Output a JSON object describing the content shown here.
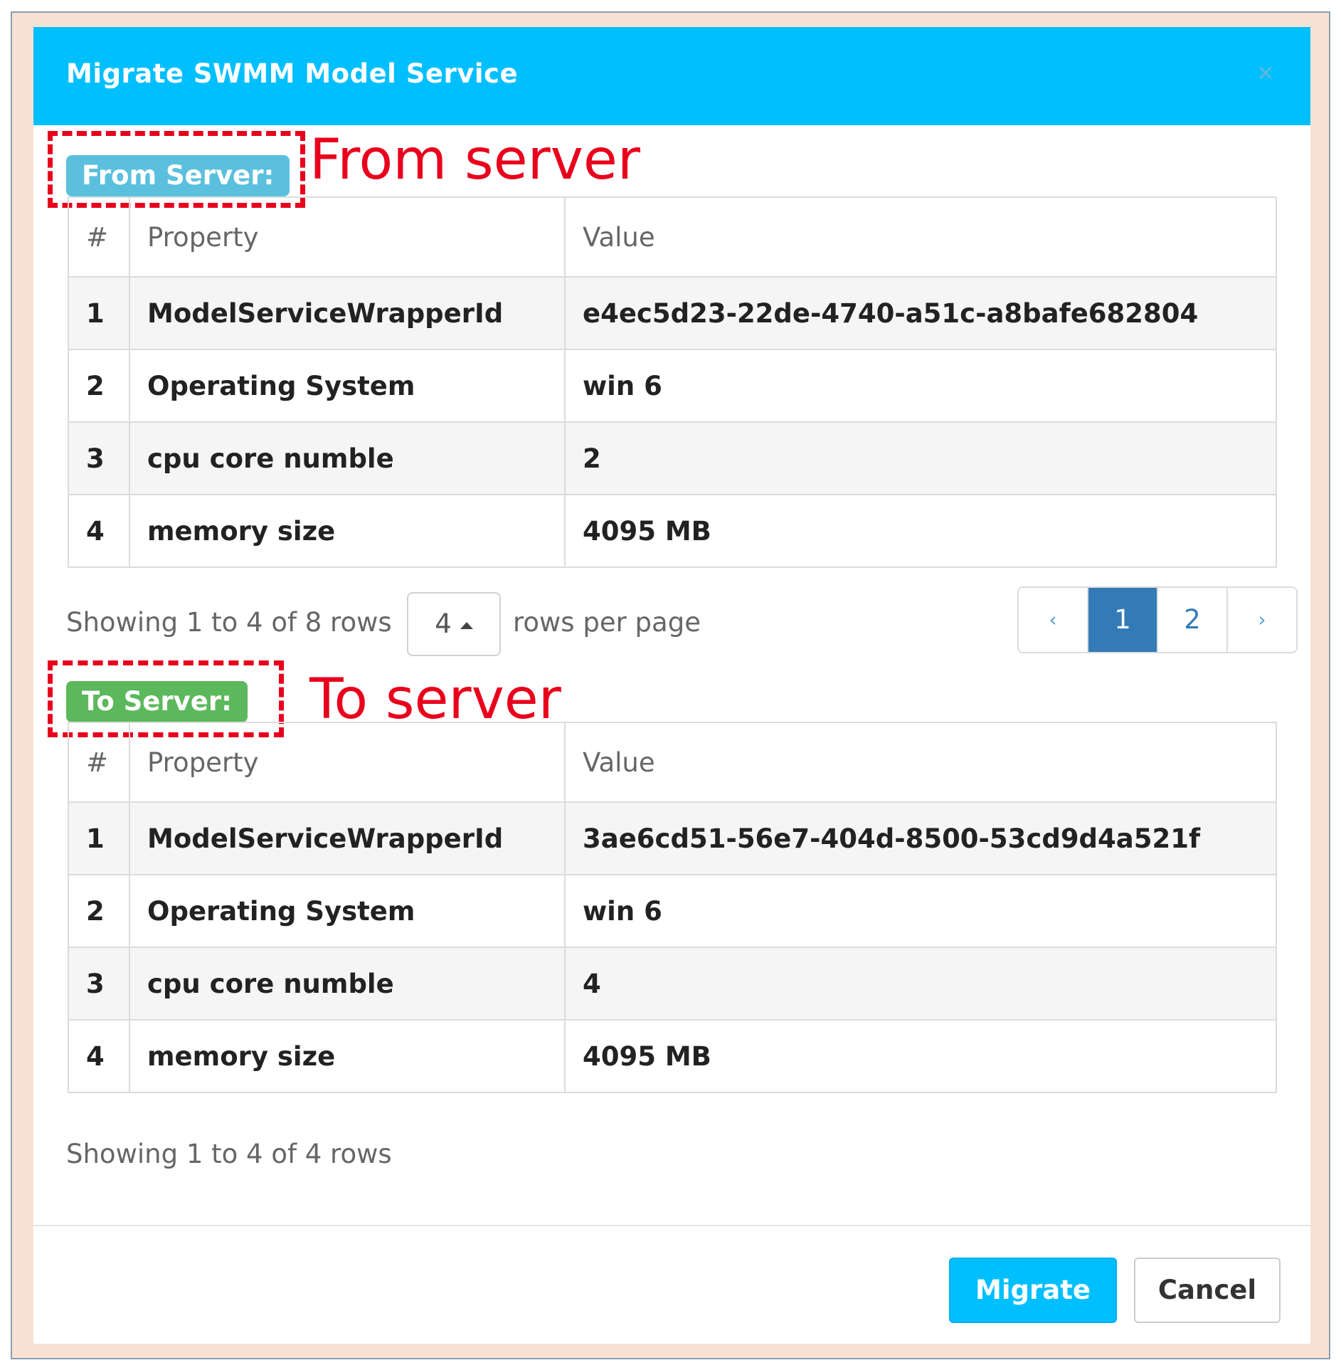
{
  "modal": {
    "title": "Migrate SWMM Model Service",
    "close_glyph": "×"
  },
  "from_section": {
    "badge": "From Server:",
    "annotation": "From server",
    "table": {
      "headers": [
        "#",
        "Property",
        "Value"
      ],
      "rows": [
        [
          "1",
          "ModelServiceWrapperId",
          "e4ec5d23-22de-4740-a51c-a8bafe682804"
        ],
        [
          "2",
          "Operating System",
          "win 6"
        ],
        [
          "3",
          "cpu core numble",
          "2"
        ],
        [
          "4",
          "memory size",
          "4095 MB"
        ]
      ]
    },
    "pagination_info": "Showing 1 to 4 of 8 rows",
    "page_size": "4",
    "rows_per_page_label": "rows per page",
    "pages": {
      "prev": "‹",
      "page1": "1",
      "page2": "2",
      "next": "›",
      "current": "1"
    }
  },
  "to_section": {
    "badge": "To Server:",
    "annotation": "To server",
    "table": {
      "headers": [
        "#",
        "Property",
        "Value"
      ],
      "rows": [
        [
          "1",
          "ModelServiceWrapperId",
          "3ae6cd51-56e7-404d-8500-53cd9d4a521f"
        ],
        [
          "2",
          "Operating System",
          "win 6"
        ],
        [
          "3",
          "cpu core numble",
          "4"
        ],
        [
          "4",
          "memory size",
          "4095 MB"
        ]
      ]
    },
    "pagination_info": "Showing 1 to 4 of 4 rows"
  },
  "footer": {
    "migrate_label": "Migrate",
    "cancel_label": "Cancel"
  },
  "colors": {
    "header_bg": "#00bfff",
    "from_badge": "#5bc0de",
    "to_badge": "#5cb85c",
    "annotation_red": "#e8001c",
    "page_active": "#337ab7"
  }
}
